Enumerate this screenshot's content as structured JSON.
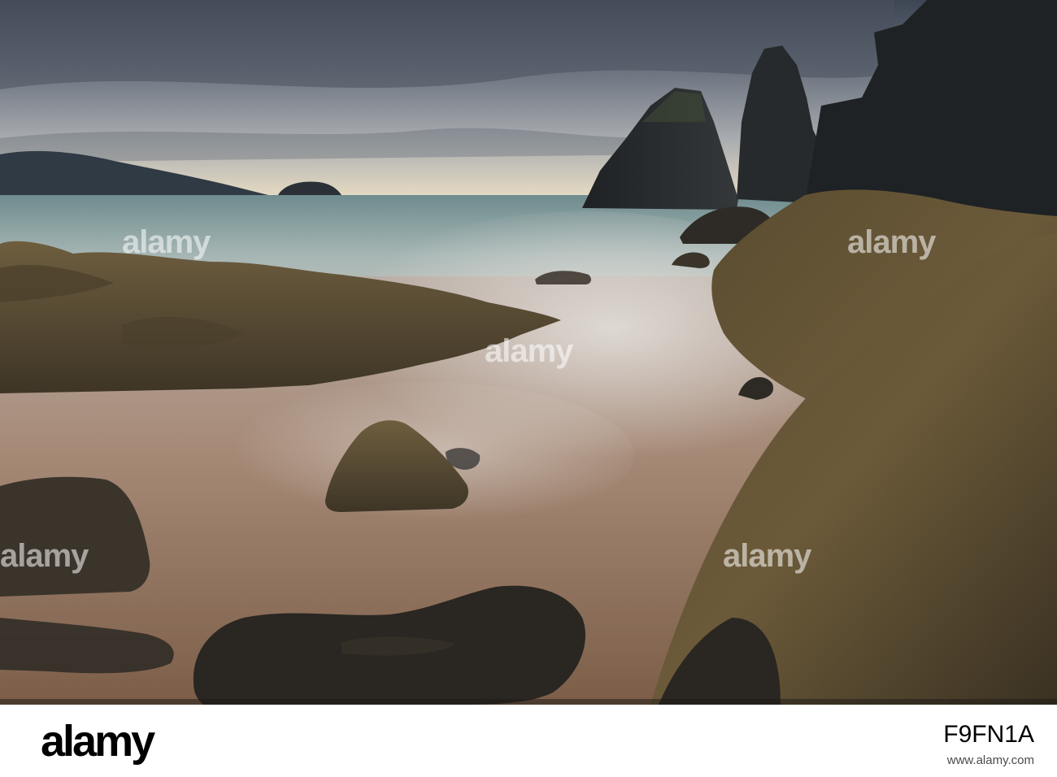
{
  "photo": {
    "subject": "long exposure seascape with rocks and sea stacks at dusk",
    "colors": {
      "sky_top": "#3c4552",
      "sky_mid": "#8f96a0",
      "horizon_glow": "#e9ddc4",
      "sea_far": "#8fa7a4",
      "water_near": "#a0816e",
      "rock_dark": "#2a2826",
      "rock_moss": "#6b5c3b"
    }
  },
  "watermark": {
    "text": "alamy"
  },
  "footer": {
    "brand": "alamy",
    "image_id": "F9FN1A",
    "credit": "www.alamy.com"
  }
}
